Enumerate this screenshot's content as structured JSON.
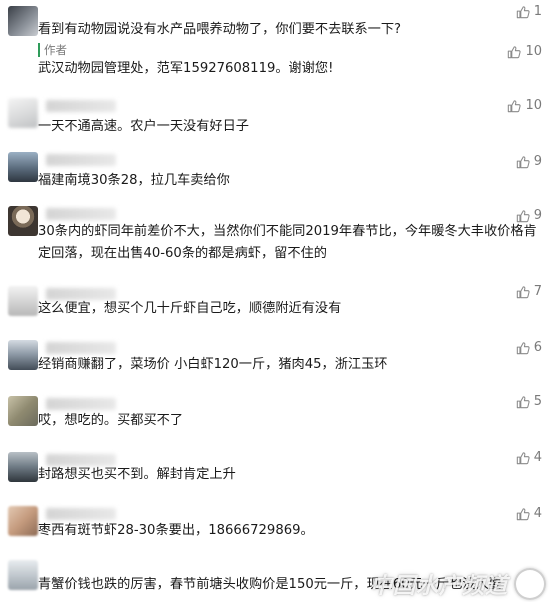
{
  "comments": [
    {
      "text": "看到有动物园说没有水产品喂养动物了，你们要不去联系一下?",
      "likes": "1"
    },
    {
      "author_label": "作者",
      "text": "武汉动物园管理处，范军15927608119。谢谢您!",
      "likes": "10"
    },
    {
      "text": "一天不通高速。农户一天没有好日子",
      "likes": "10"
    },
    {
      "text": "福建南境30条28，拉几车卖给你",
      "likes": "9"
    },
    {
      "text": "30条内的虾同年前差价不大，当然你们不能同2019年春节比，今年暖冬大丰收价格肯定回落，现在出售40-60条的都是病虾，留不住的",
      "likes": "9"
    },
    {
      "text": "这么便宜，想买个几十斤虾自己吃，顺德附近有没有",
      "likes": "7"
    },
    {
      "text": "经销商赚翻了，菜场价  小白虾120一斤，猪肉45，浙江玉环",
      "likes": "6"
    },
    {
      "text": "哎，想吃的。买都买不了",
      "likes": "5"
    },
    {
      "text": "封路想买也买不到。解封肯定上升",
      "likes": "4"
    },
    {
      "text": "枣西有斑节虾28-30条要出，18666729869。",
      "likes": "4"
    },
    {
      "text": "青蟹价钱也跌的厉害，春节前塘头收购价是150元一斤，现在60元一斤也没人要"
    }
  ],
  "watermark": {
    "text": "中国水产频道"
  },
  "icons": {
    "like": "thumbs-up-icon"
  }
}
